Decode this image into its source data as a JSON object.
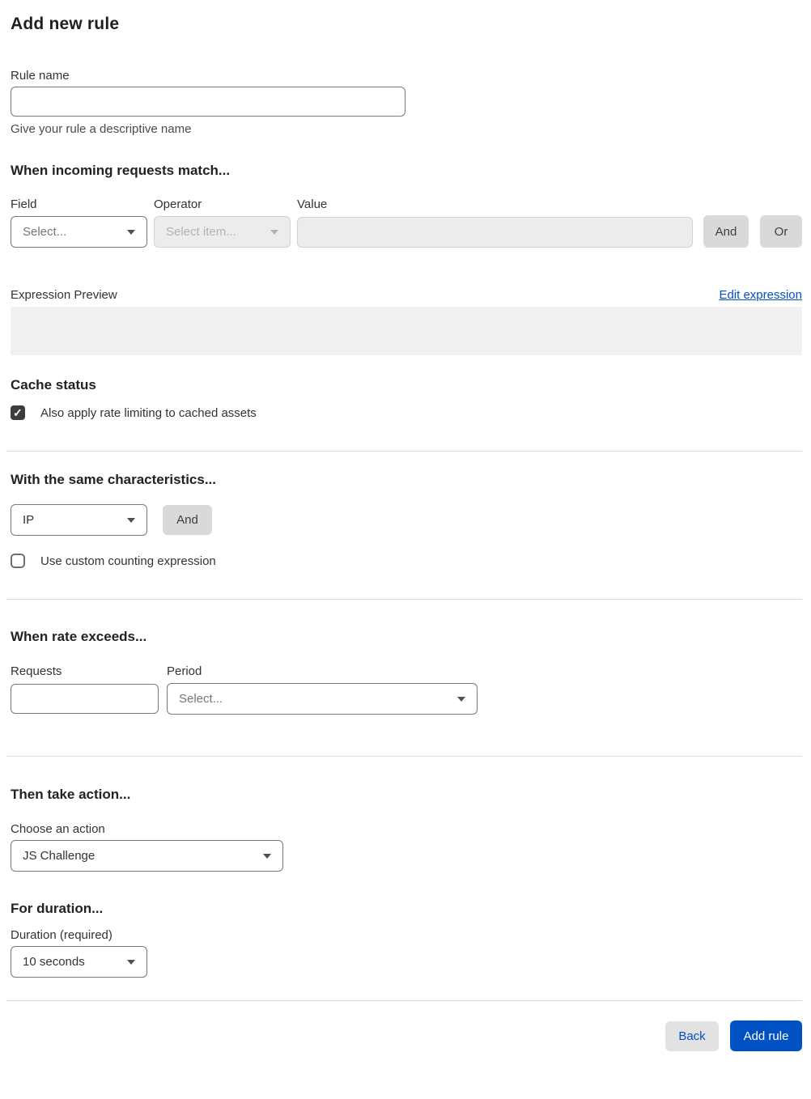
{
  "page": {
    "title": "Add new rule"
  },
  "rule_name": {
    "label": "Rule name",
    "value": "",
    "helper": "Give your rule a descriptive name"
  },
  "match": {
    "heading": "When incoming requests match...",
    "field": {
      "label": "Field",
      "value": "Select..."
    },
    "operator": {
      "label": "Operator",
      "value": "Select item..."
    },
    "value": {
      "label": "Value",
      "value": ""
    },
    "and_label": "And",
    "or_label": "Or"
  },
  "expression": {
    "preview_label": "Expression Preview",
    "edit_link_label": "Edit expression",
    "preview_value": ""
  },
  "cache_status": {
    "heading": "Cache status",
    "checkbox_label": "Also apply rate limiting to cached assets",
    "checked": true
  },
  "characteristics": {
    "heading": "With the same characteristics...",
    "select_value": "IP",
    "and_label": "And",
    "checkbox_label": "Use custom counting expression",
    "checked": false
  },
  "rate": {
    "heading": "When rate exceeds...",
    "requests_label": "Requests",
    "requests_value": "",
    "period_label": "Period",
    "period_value": "Select..."
  },
  "action": {
    "heading": "Then take action...",
    "label": "Choose an action",
    "value": "JS Challenge"
  },
  "duration": {
    "heading": "For duration...",
    "label": "Duration (required)",
    "value": "10 seconds"
  },
  "footer": {
    "back_label": "Back",
    "add_rule_label": "Add rule"
  },
  "colors": {
    "accent_blue": "#0051c3",
    "disabled_bg": "#ececec",
    "preview_bg": "#f1f1f1",
    "checkbox_checked": "#3d3d3d"
  }
}
